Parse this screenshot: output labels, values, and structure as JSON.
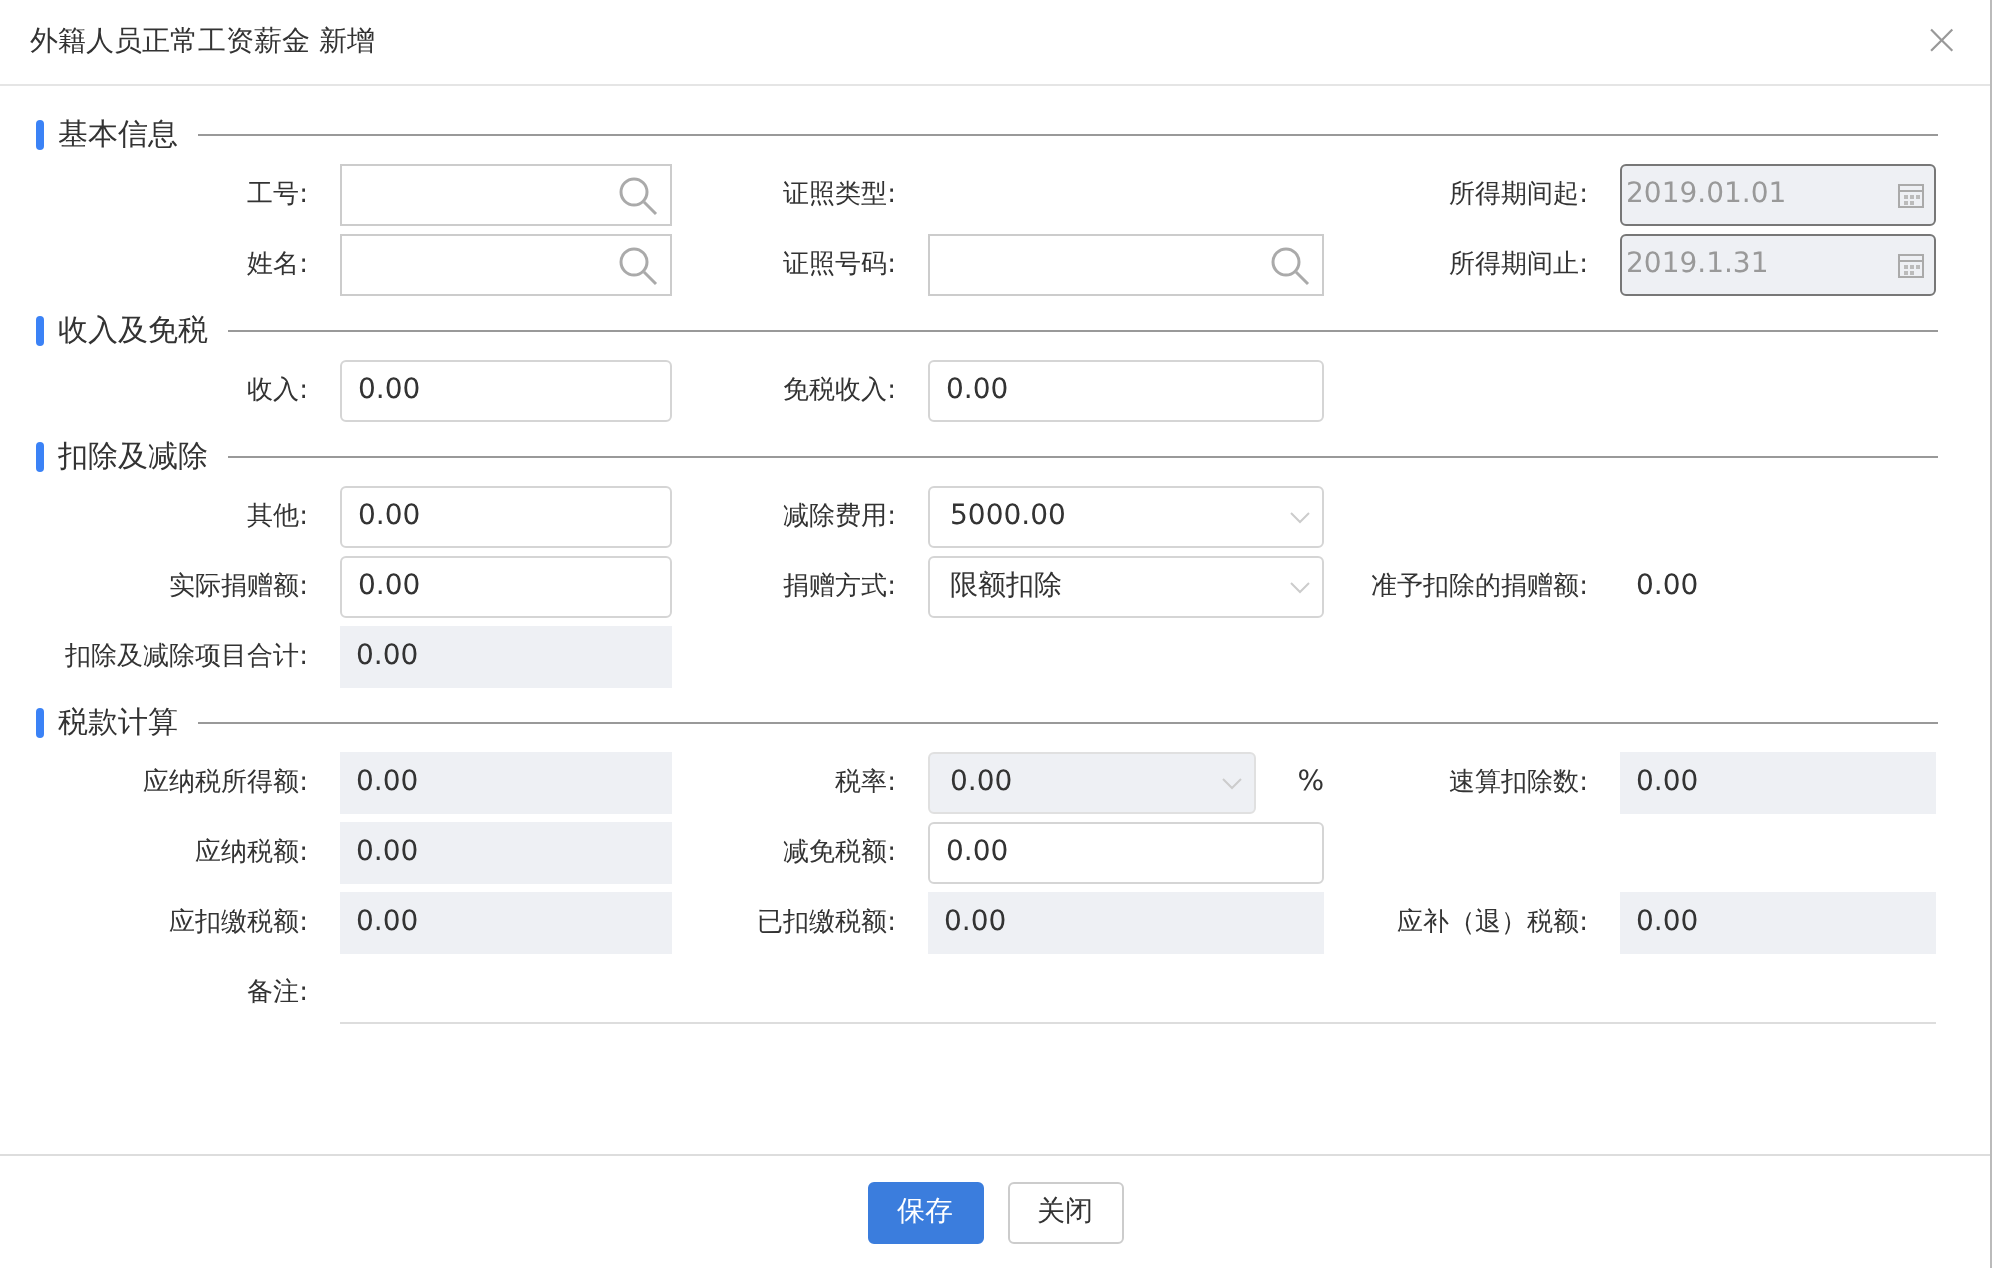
{
  "dialog": {
    "title": "外籍人员正常工资薪金 新增",
    "close": "×"
  },
  "sections": [
    {
      "title": "基本信息",
      "rows": [
        [
          {
            "label": "工号:",
            "kind": "search"
          },
          {
            "label": "证照类型:",
            "kind": "none"
          },
          {
            "label": "所得期间起:",
            "kind": "date",
            "value": "2019.01.01"
          }
        ],
        [
          {
            "label": "姓名:",
            "kind": "search"
          },
          {
            "label": "证照号码:",
            "kind": "search"
          },
          {
            "label": "所得期间止:",
            "kind": "date",
            "value": "2019.1.31"
          }
        ]
      ]
    },
    {
      "title": "收入及免税",
      "rows": [
        [
          {
            "label": "收入:",
            "kind": "text",
            "value": "0.00"
          },
          {
            "label": "免税收入:",
            "kind": "text",
            "value": "0.00"
          }
        ]
      ]
    },
    {
      "title": "扣除及减除",
      "rows": [
        [
          {
            "label": "其他:",
            "kind": "text",
            "value": "0.00"
          },
          {
            "label": "减除费用:",
            "kind": "select",
            "value": "5000.00"
          }
        ],
        [
          {
            "label": "实际捐赠额:",
            "kind": "text",
            "value": "0.00"
          },
          {
            "label": "捐赠方式:",
            "kind": "select",
            "value": "限额扣除"
          },
          {
            "label": "准予扣除的捐赠额:",
            "kind": "plain",
            "value": "0.00"
          }
        ],
        [
          {
            "label": "扣除及减除项目合计:",
            "kind": "readonly",
            "value": "0.00"
          }
        ]
      ]
    },
    {
      "title": "税款计算",
      "rows": [
        [
          {
            "label": "应纳税所得额:",
            "kind": "readonly",
            "value": "0.00"
          },
          {
            "label": "税率:",
            "kind": "select-disabled",
            "value": "0.00",
            "suffix": "%"
          },
          {
            "label": "速算扣除数:",
            "kind": "readonly",
            "value": "0.00"
          }
        ],
        [
          {
            "label": "应纳税额:",
            "kind": "readonly",
            "value": "0.00"
          },
          {
            "label": "减免税额:",
            "kind": "text",
            "value": "0.00"
          }
        ],
        [
          {
            "label": "应扣缴税额:",
            "kind": "readonly",
            "value": "0.00"
          },
          {
            "label": "已扣缴税额:",
            "kind": "readonly",
            "value": "0.00"
          },
          {
            "label": "应补（退）税额:",
            "kind": "readonly",
            "value": "0.00"
          }
        ],
        [
          {
            "label": "备注:",
            "kind": "remarks"
          }
        ]
      ]
    }
  ],
  "buttons": [
    {
      "label": "保存",
      "kind": "primary"
    },
    {
      "label": "关闭",
      "kind": "default"
    }
  ]
}
